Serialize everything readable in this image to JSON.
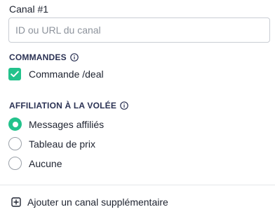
{
  "channel": {
    "label": "Canal #1",
    "input_value": "",
    "input_placeholder": "ID ou URL du canal"
  },
  "commands": {
    "heading": "COMMANDES",
    "info_icon": "info-circle-icon",
    "items": [
      {
        "label": "Commande /deal",
        "checked": true
      }
    ]
  },
  "affiliation": {
    "heading": "AFFILIATION À LA VOLÉE",
    "info_icon": "info-circle-icon",
    "options": [
      {
        "label": "Messages affiliés",
        "selected": true
      },
      {
        "label": "Tableau de prix",
        "selected": false
      },
      {
        "label": "Aucune",
        "selected": false
      }
    ]
  },
  "add_channel": {
    "icon": "plus-square-icon",
    "label": "Ajouter un canal supplémentaire"
  },
  "colors": {
    "accent": "#23c28c",
    "heading": "#2a3153",
    "text": "#1e2330",
    "border": "#c9cdd4",
    "placeholder": "#8d939c"
  }
}
